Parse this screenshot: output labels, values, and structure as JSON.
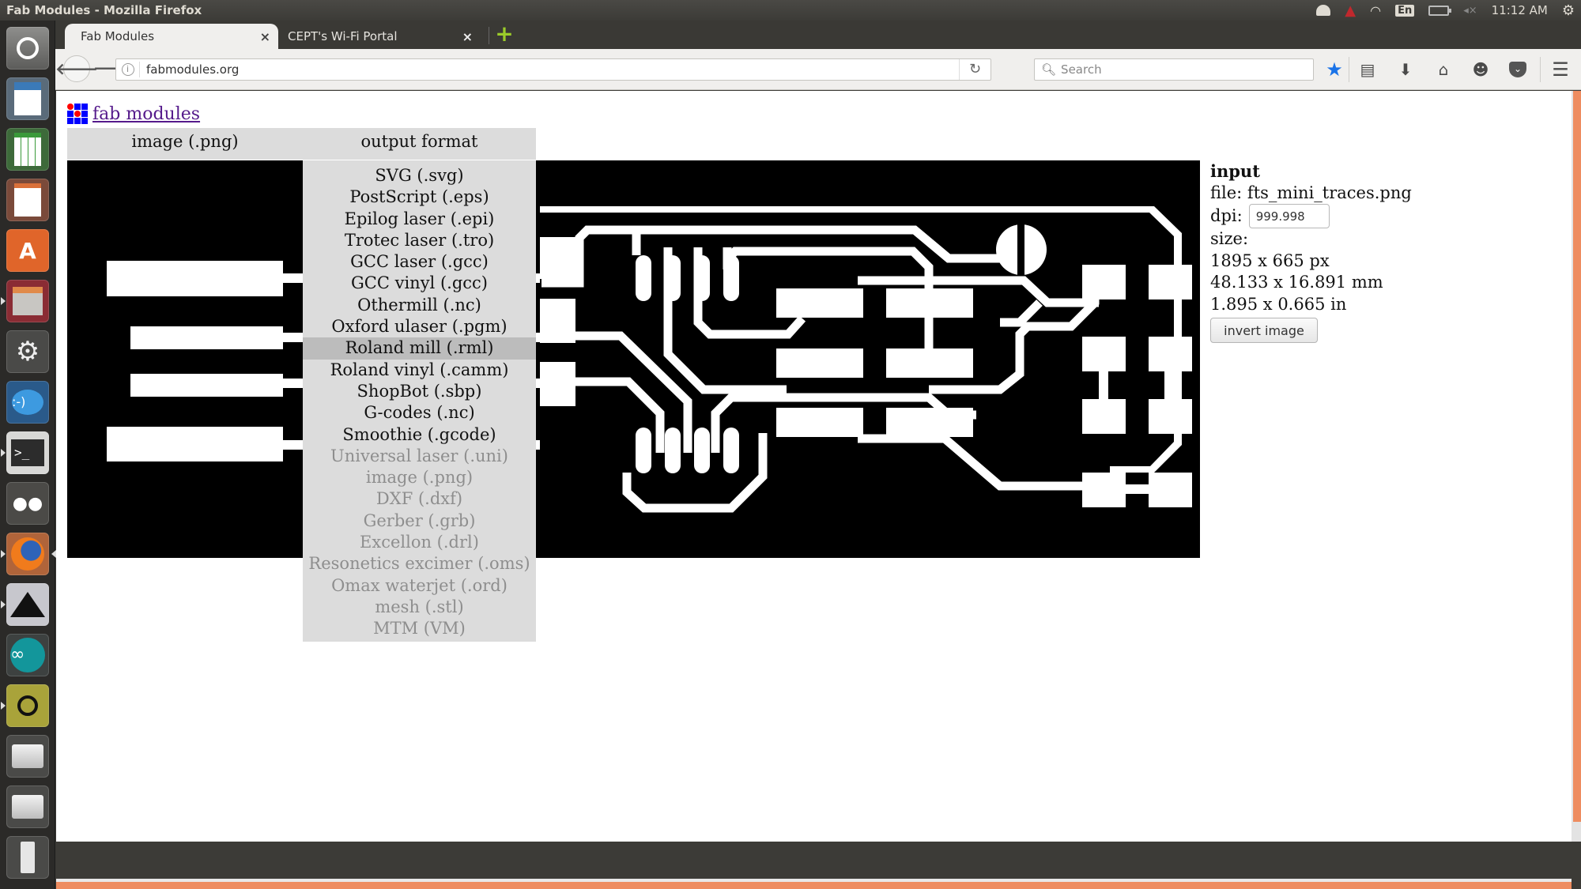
{
  "system": {
    "window_title": "Fab Modules - Mozilla Firefox",
    "clock": "11:12 AM",
    "keyboard_layout": "En",
    "indicators": [
      "dropbox-icon",
      "alert-icon",
      "wifi-icon",
      "keyboard-layout-icon",
      "battery-icon",
      "volume-muted-icon",
      "power-gear-icon"
    ]
  },
  "launcher": {
    "items": [
      {
        "name": "ubuntu-dash",
        "icon": "ubuntu-logo-icon"
      },
      {
        "name": "libreoffice-writer",
        "icon": "writer-icon"
      },
      {
        "name": "libreoffice-calc",
        "icon": "calc-icon"
      },
      {
        "name": "libreoffice-impress",
        "icon": "impress-icon"
      },
      {
        "name": "ubuntu-software-center",
        "icon": "software-center-icon"
      },
      {
        "name": "files",
        "icon": "file-cabinet-icon"
      },
      {
        "name": "system-settings",
        "icon": "settings-wrench-icon"
      },
      {
        "name": "empathy",
        "icon": "chat-bubble-icon"
      },
      {
        "name": "terminal",
        "icon": "terminal-icon"
      },
      {
        "name": "gimp",
        "icon": "gimp-icon"
      },
      {
        "name": "firefox",
        "icon": "firefox-icon"
      },
      {
        "name": "inkscape",
        "icon": "inkscape-icon"
      },
      {
        "name": "arduino",
        "icon": "arduino-icon"
      },
      {
        "name": "image-viewer",
        "icon": "image-search-icon"
      },
      {
        "name": "drive-1",
        "icon": "hard-drive-icon"
      },
      {
        "name": "drive-2",
        "icon": "hard-drive-icon"
      },
      {
        "name": "usb-drive",
        "icon": "usb-icon"
      }
    ]
  },
  "browser": {
    "tabs": [
      {
        "label": "Fab Modules",
        "active": true
      },
      {
        "label": "CEPT's Wi-Fi Portal",
        "active": false
      }
    ],
    "url": "fabmodules.org",
    "search_placeholder": "Search",
    "close_glyph": "×",
    "new_tab_glyph": "+"
  },
  "page": {
    "logo_text": "fab modules",
    "columns": {
      "input_header": "image (.png)",
      "output_header": "output format"
    },
    "output_formats": [
      {
        "label": "SVG (.svg)",
        "enabled": true
      },
      {
        "label": "PostScript (.eps)",
        "enabled": true
      },
      {
        "label": "Epilog laser (.epi)",
        "enabled": true
      },
      {
        "label": "Trotec laser (.tro)",
        "enabled": true
      },
      {
        "label": "GCC laser (.gcc)",
        "enabled": true
      },
      {
        "label": "GCC vinyl (.gcc)",
        "enabled": true
      },
      {
        "label": "Othermill (.nc)",
        "enabled": true
      },
      {
        "label": "Oxford ulaser (.pgm)",
        "enabled": true
      },
      {
        "label": "Roland mill (.rml)",
        "enabled": true,
        "highlighted": true
      },
      {
        "label": "Roland vinyl (.camm)",
        "enabled": true
      },
      {
        "label": "ShopBot (.sbp)",
        "enabled": true
      },
      {
        "label": "G-codes (.nc)",
        "enabled": true
      },
      {
        "label": "Smoothie (.gcode)",
        "enabled": true
      },
      {
        "label": "Universal laser (.uni)",
        "enabled": false
      },
      {
        "label": "image (.png)",
        "enabled": false
      },
      {
        "label": "DXF (.dxf)",
        "enabled": false
      },
      {
        "label": "Gerber (.grb)",
        "enabled": false
      },
      {
        "label": "Excellon (.drl)",
        "enabled": false
      },
      {
        "label": "Resonetics excimer (.oms)",
        "enabled": false
      },
      {
        "label": "Omax waterjet (.ord)",
        "enabled": false
      },
      {
        "label": "mesh (.stl)",
        "enabled": false
      },
      {
        "label": "MTM (VM)",
        "enabled": false
      }
    ],
    "input_panel": {
      "heading": "input",
      "file_label": "file:",
      "file_name": "fts_mini_traces.png",
      "dpi_label": "dpi:",
      "dpi_value": "999.998",
      "size_label": "size:",
      "size_px": "1895 x 665 px",
      "size_mm": "48.133 x 16.891 mm",
      "size_in": "1.895 x 0.665 in",
      "invert_button": "invert image"
    }
  },
  "colors": {
    "accent_scrollbar": "#ee8c60",
    "logo_blue": "#0000ff",
    "logo_red": "#ff0000",
    "link_visited": "#551a8b",
    "bookmark_star": "#1a73e8",
    "new_tab_plus": "#9bcc2a"
  }
}
